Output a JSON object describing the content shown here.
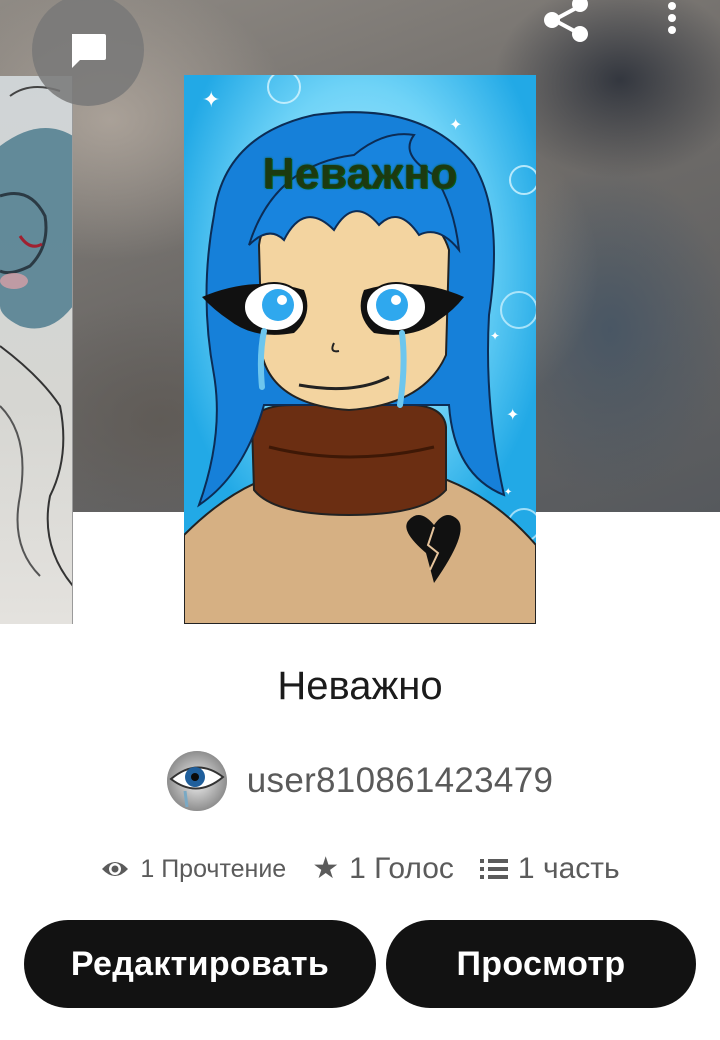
{
  "cover": {
    "title": "Неважно"
  },
  "story": {
    "title": "Неважно"
  },
  "author": {
    "name": "user810861423479"
  },
  "stats": {
    "reads": "1 Прочтение",
    "votes": "1 Голос",
    "parts": "1 часть"
  },
  "actions": {
    "edit_label": "Редактировать",
    "view_label": "Просмотр"
  },
  "icons": {
    "chat": "chat-bubble-icon",
    "share": "share-icon",
    "menu": "more-vertical-icon",
    "reads": "eye-icon",
    "votes": "star-icon",
    "parts": "list-icon"
  },
  "colors": {
    "button_bg": "#121212",
    "cover_bg": "#33b6ea"
  }
}
